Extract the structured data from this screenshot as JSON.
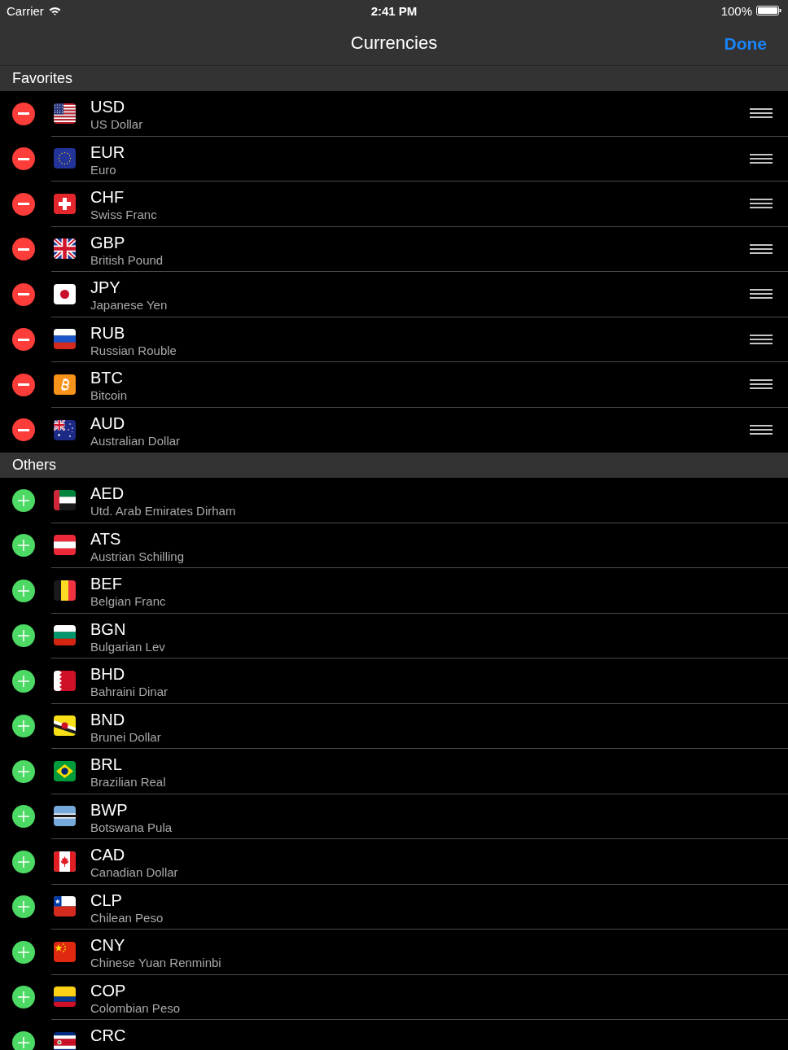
{
  "status_bar": {
    "carrier": "Carrier",
    "time": "2:41 PM",
    "battery": "100%"
  },
  "nav_bar": {
    "title": "Currencies",
    "done_button": "Done"
  },
  "sections": [
    {
      "title": "Favorites",
      "kind": "favorites",
      "rows": [
        {
          "code": "USD",
          "name": "US Dollar"
        },
        {
          "code": "EUR",
          "name": "Euro"
        },
        {
          "code": "CHF",
          "name": "Swiss Franc"
        },
        {
          "code": "GBP",
          "name": "British Pound"
        },
        {
          "code": "JPY",
          "name": "Japanese Yen"
        },
        {
          "code": "RUB",
          "name": "Russian Rouble"
        },
        {
          "code": "BTC",
          "name": "Bitcoin"
        },
        {
          "code": "AUD",
          "name": "Australian Dollar"
        }
      ]
    },
    {
      "title": "Others",
      "kind": "others",
      "rows": [
        {
          "code": "AED",
          "name": "Utd. Arab Emirates Dirham"
        },
        {
          "code": "ATS",
          "name": "Austrian Schilling"
        },
        {
          "code": "BEF",
          "name": "Belgian Franc"
        },
        {
          "code": "BGN",
          "name": "Bulgarian Lev"
        },
        {
          "code": "BHD",
          "name": "Bahraini Dinar"
        },
        {
          "code": "BND",
          "name": "Brunei Dollar"
        },
        {
          "code": "BRL",
          "name": "Brazilian Real"
        },
        {
          "code": "BWP",
          "name": "Botswana Pula"
        },
        {
          "code": "CAD",
          "name": "Canadian Dollar"
        },
        {
          "code": "CLP",
          "name": "Chilean Peso"
        },
        {
          "code": "CNY",
          "name": "Chinese Yuan Renminbi"
        },
        {
          "code": "COP",
          "name": "Colombian Peso"
        },
        {
          "code": "CRC"
        }
      ]
    }
  ]
}
